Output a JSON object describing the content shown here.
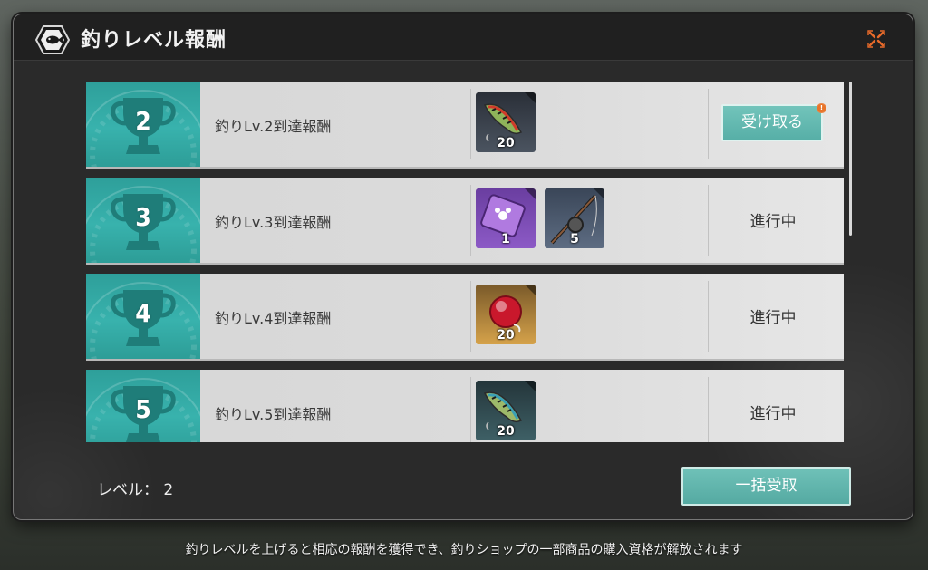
{
  "dialog": {
    "title": "釣りレベル報酬",
    "title_icon": "fish-icon",
    "close_icon": "close-icon"
  },
  "rewards": [
    {
      "level": "2",
      "title": "釣りLv.2到達報酬",
      "items": [
        {
          "icon": "lure-icon",
          "count": "20"
        }
      ],
      "action": "受け取る",
      "claimable": true
    },
    {
      "level": "3",
      "title": "釣りLv.3到達報酬",
      "items": [
        {
          "icon": "ticket-icon",
          "count": "1"
        },
        {
          "icon": "fishing-rod-icon",
          "count": "5"
        }
      ],
      "status": "進行中",
      "claimable": false
    },
    {
      "level": "4",
      "title": "釣りLv.4到達報酬",
      "items": [
        {
          "icon": "red-token-icon",
          "count": "20"
        }
      ],
      "status": "進行中",
      "claimable": false
    },
    {
      "level": "5",
      "title": "釣りLv.5到達報酬",
      "items": [
        {
          "icon": "lure-icon",
          "count": "20"
        }
      ],
      "status": "進行中",
      "claimable": false
    }
  ],
  "footer_bar": {
    "level_label": "レベル：",
    "level_value": "2",
    "claim_all_label": "一括受取"
  },
  "hint": "釣りレベルを上げると相応の報酬を獲得でき、釣りショップの一部商品の購入資格が解放されます",
  "colors": {
    "accent_teal": "#38b2ad",
    "button_teal": "#5fb6ad",
    "alert_orange": "#e8742a",
    "close_orange": "#e86a2a"
  }
}
